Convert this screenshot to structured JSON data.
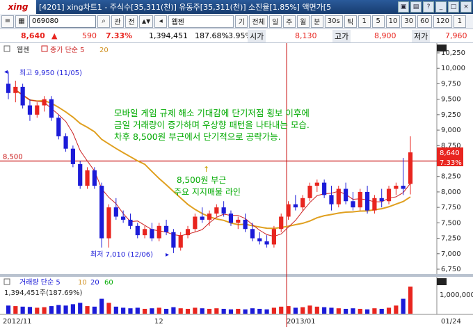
{
  "window": {
    "logo": "xing",
    "title": "[4201] xing차트1 - 주식수[35,311(천)] 유동주[35,311(천)] 소진율[1.85%] 액면가[5..."
  },
  "toolbar": {
    "code": "069080",
    "stock_name": "웹젠",
    "buttons": [
      "관",
      "전",
      "기",
      "전체",
      "일",
      "주",
      "월",
      "분",
      "30s",
      "틱"
    ],
    "periods": [
      "1",
      "5",
      "10",
      "30",
      "60",
      "120",
      "1"
    ]
  },
  "quote": {
    "price": "8,640",
    "change_arrow": "▲",
    "change": "590",
    "change_pct": "7.33%",
    "volume": "1,394,451",
    "volume_ratio": "187.68%",
    "turnover": "3.95%",
    "open_label": "시가",
    "open": "8,130",
    "high_label": "고가",
    "high": "8,900",
    "low_label": "저가",
    "low": "7,960"
  },
  "price_panel": {
    "legend_name": "웹젠",
    "legend_ma": "종가 단순 5",
    "legend_ma2": "20",
    "hline_label": "8,500",
    "high_marker": "최고 9,950 (11/05)",
    "low_marker": "최저 7,010 (12/06)",
    "current_price_box": "8,640",
    "current_pct_box": "7.33%",
    "annotation_line1": "모바일 게임 규제 해소 기대감에 단기저점 횡보 이후에",
    "annotation_line2": "금일 거래량이 증가하며 우상향 패턴을 나타내는 모습.",
    "annotation_line3": "차후 8,500원 부근에서 단기적으로 공략가능.",
    "support_line1": "8,500원 부근",
    "support_line2": "주요 지지매물 라인",
    "arrow_up": "↑",
    "y_ticks": [
      "10,250",
      "10,000",
      "9,750",
      "9,500",
      "9,250",
      "9,000",
      "8,750",
      "8,250",
      "8,000",
      "7,750",
      "7,500",
      "7,250",
      "7,000",
      "6,750"
    ]
  },
  "volume_panel": {
    "legend": "거래량 단순 5",
    "legend_ma1": "10",
    "legend_ma2": "20",
    "legend_ma3": "60",
    "current": "1,394,451주(187.69%)",
    "y_tick": "1,000,000"
  },
  "xaxis": {
    "labels": [
      "2012/11",
      "12",
      "2013/01",
      "01/24"
    ]
  },
  "colors": {
    "up": "#e8251f",
    "down": "#1b1bd8",
    "ma5": "#cc2222",
    "ma20": "#e0a020",
    "annotation": "#00aa00",
    "hline": "#d01010"
  },
  "chart_data": {
    "type": "candlestick",
    "ylim": [
      6750,
      10250
    ],
    "candles": [
      {
        "o": 9750,
        "h": 9950,
        "l": 9500,
        "c": 9600
      },
      {
        "o": 9600,
        "h": 9800,
        "l": 9450,
        "c": 9700
      },
      {
        "o": 9700,
        "h": 9750,
        "l": 9350,
        "c": 9400
      },
      {
        "o": 9400,
        "h": 9500,
        "l": 9150,
        "c": 9250
      },
      {
        "o": 9250,
        "h": 9450,
        "l": 9200,
        "c": 9400
      },
      {
        "o": 9400,
        "h": 9550,
        "l": 9300,
        "c": 9500
      },
      {
        "o": 9500,
        "h": 9550,
        "l": 9150,
        "c": 9200
      },
      {
        "o": 9200,
        "h": 9250,
        "l": 8850,
        "c": 8900
      },
      {
        "o": 8900,
        "h": 8950,
        "l": 8650,
        "c": 8700
      },
      {
        "o": 8700,
        "h": 8750,
        "l": 8400,
        "c": 8450
      },
      {
        "o": 8450,
        "h": 8500,
        "l": 8050,
        "c": 8100
      },
      {
        "o": 8100,
        "h": 8400,
        "l": 8050,
        "c": 8350
      },
      {
        "o": 8350,
        "h": 8400,
        "l": 8050,
        "c": 8100
      },
      {
        "o": 8100,
        "h": 8150,
        "l": 7100,
        "c": 7250
      },
      {
        "o": 7250,
        "h": 7800,
        "l": 7100,
        "c": 7750
      },
      {
        "o": 7750,
        "h": 7900,
        "l": 7550,
        "c": 7600
      },
      {
        "o": 7600,
        "h": 7700,
        "l": 7500,
        "c": 7550
      },
      {
        "o": 7550,
        "h": 7650,
        "l": 7400,
        "c": 7450
      },
      {
        "o": 7450,
        "h": 7500,
        "l": 7250,
        "c": 7300
      },
      {
        "o": 7300,
        "h": 7450,
        "l": 7250,
        "c": 7400
      },
      {
        "o": 7400,
        "h": 7500,
        "l": 7200,
        "c": 7250
      },
      {
        "o": 7250,
        "h": 7500,
        "l": 7200,
        "c": 7450
      },
      {
        "o": 7450,
        "h": 7550,
        "l": 7300,
        "c": 7350
      },
      {
        "o": 7350,
        "h": 7400,
        "l": 7010,
        "c": 7100
      },
      {
        "o": 7100,
        "h": 7350,
        "l": 7050,
        "c": 7300
      },
      {
        "o": 7300,
        "h": 7450,
        "l": 7250,
        "c": 7400
      },
      {
        "o": 7400,
        "h": 7650,
        "l": 7350,
        "c": 7600
      },
      {
        "o": 7600,
        "h": 7750,
        "l": 7500,
        "c": 7550
      },
      {
        "o": 7550,
        "h": 7700,
        "l": 7450,
        "c": 7650
      },
      {
        "o": 7650,
        "h": 7800,
        "l": 7600,
        "c": 7750
      },
      {
        "o": 7750,
        "h": 7850,
        "l": 7600,
        "c": 7650
      },
      {
        "o": 7650,
        "h": 7700,
        "l": 7450,
        "c": 7500
      },
      {
        "o": 7500,
        "h": 7600,
        "l": 7400,
        "c": 7550
      },
      {
        "o": 7550,
        "h": 7650,
        "l": 7350,
        "c": 7400
      },
      {
        "o": 7400,
        "h": 7500,
        "l": 7200,
        "c": 7250
      },
      {
        "o": 7250,
        "h": 7350,
        "l": 7150,
        "c": 7200
      },
      {
        "o": 7200,
        "h": 7300,
        "l": 7100,
        "c": 7150
      },
      {
        "o": 7150,
        "h": 7450,
        "l": 7100,
        "c": 7400
      },
      {
        "o": 7400,
        "h": 7650,
        "l": 7350,
        "c": 7600
      },
      {
        "o": 7600,
        "h": 7850,
        "l": 7550,
        "c": 7800
      },
      {
        "o": 7800,
        "h": 7950,
        "l": 7700,
        "c": 7750
      },
      {
        "o": 7750,
        "h": 7950,
        "l": 7700,
        "c": 7900
      },
      {
        "o": 7900,
        "h": 8150,
        "l": 7850,
        "c": 8100
      },
      {
        "o": 8100,
        "h": 8200,
        "l": 8000,
        "c": 8150
      },
      {
        "o": 8150,
        "h": 8200,
        "l": 7900,
        "c": 7950
      },
      {
        "o": 7950,
        "h": 8100,
        "l": 7700,
        "c": 7800
      },
      {
        "o": 7800,
        "h": 8100,
        "l": 7750,
        "c": 8050
      },
      {
        "o": 8050,
        "h": 8150,
        "l": 7800,
        "c": 7850
      },
      {
        "o": 7850,
        "h": 8000,
        "l": 7700,
        "c": 7750
      },
      {
        "o": 7750,
        "h": 8050,
        "l": 7700,
        "c": 8000
      },
      {
        "o": 8000,
        "h": 8100,
        "l": 7650,
        "c": 7700
      },
      {
        "o": 7700,
        "h": 7950,
        "l": 7650,
        "c": 7900
      },
      {
        "o": 7900,
        "h": 8050,
        "l": 7750,
        "c": 7850
      },
      {
        "o": 7850,
        "h": 8100,
        "l": 7800,
        "c": 8050
      },
      {
        "o": 8050,
        "h": 8150,
        "l": 7950,
        "c": 8100
      },
      {
        "o": 8100,
        "h": 8550,
        "l": 7950,
        "c": 8050
      },
      {
        "o": 8130,
        "h": 8900,
        "l": 7960,
        "c": 8640
      }
    ],
    "volumes": [
      30,
      28,
      26,
      25,
      22,
      24,
      28,
      32,
      30,
      35,
      40,
      28,
      26,
      55,
      40,
      26,
      22,
      20,
      22,
      18,
      20,
      22,
      18,
      24,
      20,
      18,
      22,
      20,
      18,
      20,
      18,
      16,
      18,
      16,
      20,
      18,
      16,
      22,
      26,
      28,
      22,
      24,
      30,
      26,
      24,
      22,
      20,
      18,
      20,
      18,
      16,
      20,
      18,
      22,
      30,
      55,
      100
    ]
  }
}
